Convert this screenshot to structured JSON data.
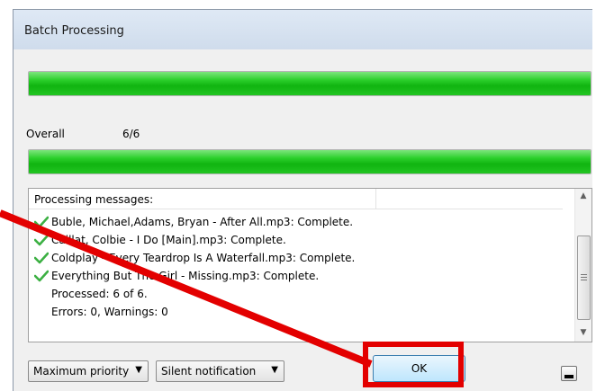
{
  "window": {
    "title": "Batch Processing"
  },
  "progress": {
    "current_fraction": 1.0,
    "overall_fraction": 1.0
  },
  "overall": {
    "label": "Overall",
    "count": "6/6"
  },
  "messages": {
    "header": "Processing messages:",
    "entries": [
      {
        "text": "Buble, Michael,Adams, Bryan - After All.mp3: Complete.",
        "icon": "checkmark-icon"
      },
      {
        "text": "Caillat, Colbie - I Do [Main].mp3: Complete.",
        "icon": "checkmark-icon"
      },
      {
        "text": "Coldplay - Every Teardrop Is A Waterfall.mp3: Complete.",
        "icon": "checkmark-icon"
      },
      {
        "text": "Everything But The Girl - Missing.mp3: Complete.",
        "icon": "checkmark-icon"
      }
    ],
    "summary": [
      "Processed: 6 of 6.",
      "Errors: 0,  Warnings: 0"
    ]
  },
  "controls": {
    "priority": "Maximum priority",
    "notification": "Silent notification",
    "ok": "OK"
  },
  "colors": {
    "progress": "#22c522",
    "check": "#3cb043",
    "highlight": "#e30000"
  }
}
